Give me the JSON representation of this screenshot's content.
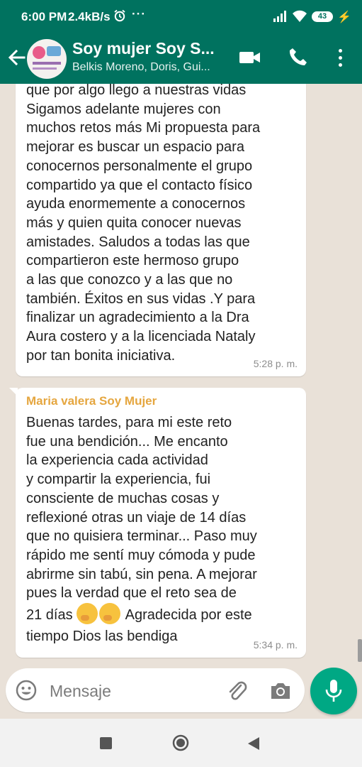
{
  "status_bar": {
    "time": "6:00 PM",
    "network_speed": "2.4kB/s",
    "alarm_icon": "alarm-icon",
    "more_dots": "···",
    "battery_level": "43",
    "charging_icon": "⚡"
  },
  "header": {
    "title": "Soy mujer Soy S...",
    "subtitle": "Belkis Moreno, Doris, Gui...",
    "icons": [
      "back-arrow-icon",
      "group-avatar",
      "video-call-icon",
      "phone-call-icon",
      "more-vert-icon"
    ]
  },
  "messages": [
    {
      "lines": [
        "que por algo llego a nuestras vidas",
        "Sigamos adelante mujeres con",
        "muchos retos más Mi propuesta para",
        "mejorar es buscar un espacio para",
        "conocernos personalmente el grupo",
        "compartido ya que el contacto físico",
        "ayuda enormemente a conocernos",
        "más y quien quita conocer nuevas",
        "amistades. Saludos  a todas las que",
        "compartieron este hermoso grupo",
        "a las que conozco y a las que no",
        "también. Éxitos en sus vidas .Y para",
        "finalizar un agradecimiento a la Dra",
        "Aura costero y a la licenciada Nataly",
        "por tan bonita iniciativa."
      ],
      "time": "5:28 p. m."
    },
    {
      "sender": "Maria valera Soy Mujer",
      "sender_color": "#e5a63f",
      "lines": [
        "Buenas tardes, para mi este reto",
        "fue una bendición... Me encanto",
        "la experiencia cada actividad",
        "y compartir la experiencia, fui",
        "consciente de muchas cosas y",
        "reflexioné otras un viaje de 14 días",
        "que no quisiera terminar... Paso muy",
        "rápido me sentí muy cómoda y pude",
        "abrirme sin tabú, sin pena. A mejorar",
        "pues la verdad que el reto sea de"
      ],
      "line_with_emoji_before": "21 días",
      "emojis": [
        "face-with-hand-over-mouth",
        "face-with-hand-over-mouth"
      ],
      "line_with_emoji_after": "Agradecida por este",
      "last_line": "tiempo Dios las bendiga",
      "time": "5:34 p. m."
    }
  ],
  "composer": {
    "placeholder": "Mensaje",
    "icons": [
      "emoji-icon",
      "attach-icon",
      "camera-icon",
      "mic-icon"
    ]
  },
  "navigation": {
    "buttons": [
      "recent-apps",
      "home",
      "back"
    ]
  },
  "colors": {
    "header_bg": "#00725f",
    "chat_bg": "#e9e1d8",
    "mic_button": "#00a884",
    "sender_name": "#e5a63f",
    "timestamp": "#8d8d8d"
  }
}
